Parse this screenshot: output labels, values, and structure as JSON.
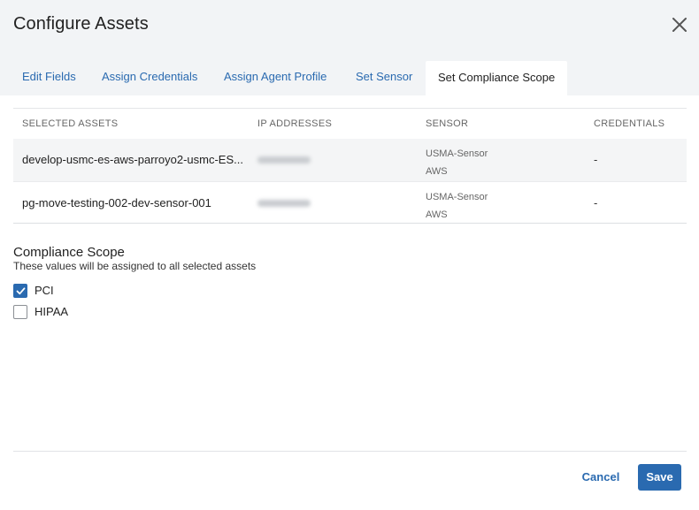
{
  "dialog": {
    "title": "Configure Assets",
    "close_icon": "close-icon"
  },
  "tabs": [
    {
      "label": "Edit Fields",
      "active": false
    },
    {
      "label": "Assign Credentials",
      "active": false
    },
    {
      "label": "Assign Agent Profile",
      "active": false
    },
    {
      "label": "Set Sensor",
      "active": false
    },
    {
      "label": "Set Compliance Scope",
      "active": true
    }
  ],
  "table": {
    "headers": [
      "SELECTED ASSETS",
      "IP ADDRESSES",
      "SENSOR",
      "CREDENTIALS"
    ],
    "rows": [
      {
        "asset": "develop-usmc-es-aws-parroyo2-usmc-ES...",
        "ip": "",
        "sensor_name": "USMA-Sensor",
        "sensor_type": "AWS",
        "credentials": "-"
      },
      {
        "asset": "pg-move-testing-002-dev-sensor-001",
        "ip": "",
        "sensor_name": "USMA-Sensor",
        "sensor_type": "AWS",
        "credentials": "-"
      }
    ]
  },
  "compliance": {
    "title": "Compliance Scope",
    "subtitle": "These values will be assigned to all selected assets",
    "options": [
      {
        "label": "PCI",
        "checked": true
      },
      {
        "label": "HIPAA",
        "checked": false
      }
    ]
  },
  "footer": {
    "cancel_label": "Cancel",
    "save_label": "Save"
  },
  "colors": {
    "accent": "#2a6ab0",
    "header_bg": "#f2f4f6"
  }
}
